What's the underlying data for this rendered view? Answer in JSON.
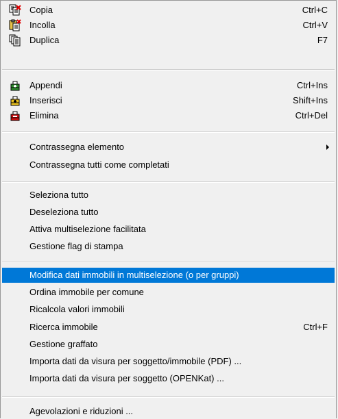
{
  "menu": {
    "groups": [
      {
        "items": [
          {
            "label": "Copia",
            "shortcut": "Ctrl+C",
            "icon": "copy-icon"
          },
          {
            "label": "Incolla",
            "shortcut": "Ctrl+V",
            "icon": "paste-icon"
          },
          {
            "label": "Duplica",
            "shortcut": "F7",
            "icon": "duplicate-icon"
          }
        ]
      },
      {
        "items": [
          {
            "label": "Appendi",
            "shortcut": "Ctrl+Ins",
            "icon": "append-icon"
          },
          {
            "label": "Inserisci",
            "shortcut": "Shift+Ins",
            "icon": "insert-icon"
          },
          {
            "label": "Elimina",
            "shortcut": "Ctrl+Del",
            "icon": "delete-icon"
          }
        ]
      },
      {
        "items": [
          {
            "label": "Contrassegna elemento",
            "has_submenu": true
          },
          {
            "label": "Contrassegna tutti come completati"
          }
        ]
      },
      {
        "items": [
          {
            "label": "Seleziona tutto"
          },
          {
            "label": "Deseleziona tutto"
          },
          {
            "label": "Attiva multiselezione facilitata"
          },
          {
            "label": "Gestione flag di stampa"
          }
        ]
      },
      {
        "items": [
          {
            "label": "Modifica dati immobili in multiselezione (o per gruppi)",
            "highlighted": true
          },
          {
            "label": "Ordina immobile per comune"
          },
          {
            "label": "Ricalcola valori immobili"
          },
          {
            "label": "Ricerca immobile",
            "shortcut": "Ctrl+F"
          },
          {
            "label": "Gestione graffato"
          },
          {
            "label": "Importa dati da visura per soggetto/immobile (PDF) ..."
          },
          {
            "label": "Importa dati da visura per soggetto (OPENKat) ..."
          }
        ]
      },
      {
        "items": [
          {
            "label": "Agevolazioni e riduzioni ..."
          }
        ]
      }
    ]
  },
  "colors": {
    "highlight": "#0078d7",
    "menu_background": "#f0f0f0",
    "separator": "#cfcfcf"
  }
}
